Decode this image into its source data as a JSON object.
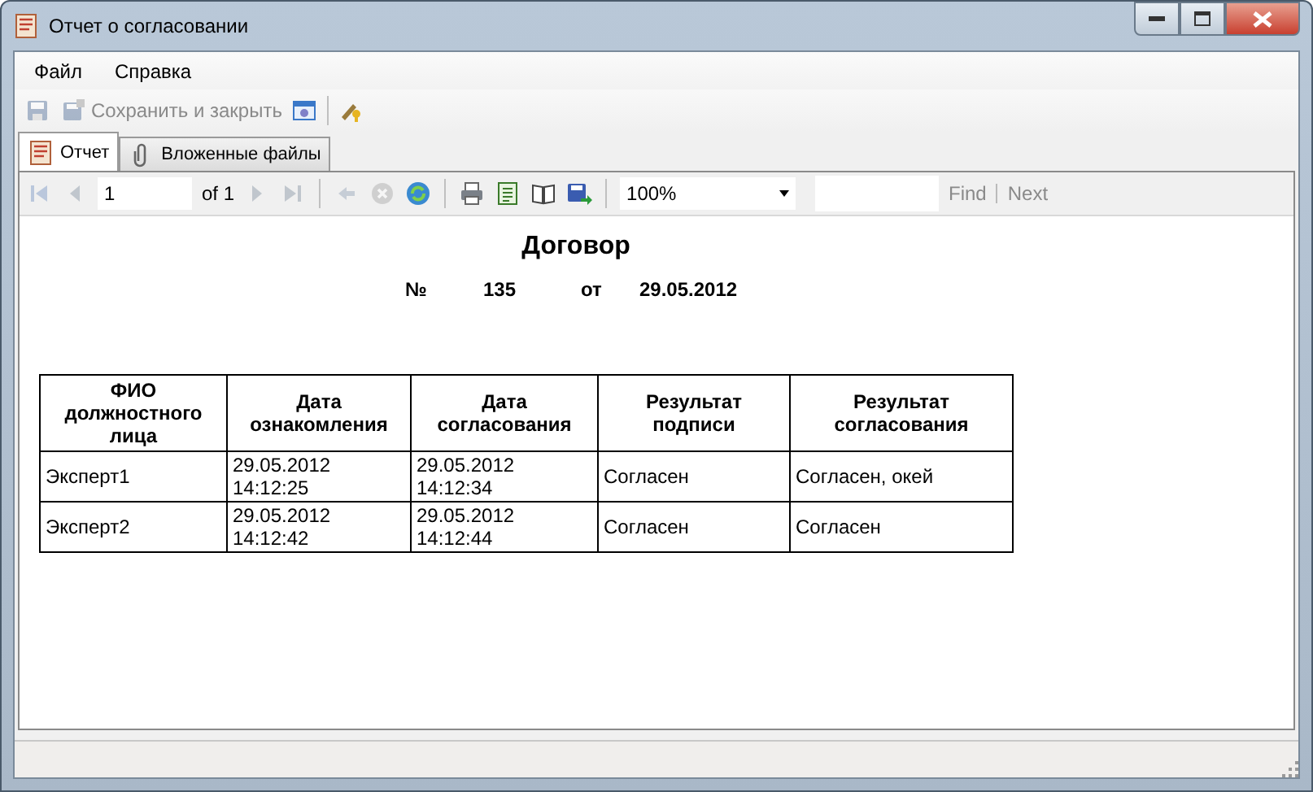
{
  "window": {
    "title": "Отчет о согласовании"
  },
  "menu": [
    {
      "label": "Файл"
    },
    {
      "label": "Справка"
    }
  ],
  "toolbar": [
    {
      "kind": "save",
      "disabled": true
    },
    {
      "kind": "save_close",
      "label": "Сохранить и закрыть",
      "disabled": true
    },
    {
      "kind": "window",
      "disabled": false
    },
    {
      "kind": "key",
      "disabled": false
    }
  ],
  "tabs": [
    {
      "kind": "report",
      "label": "Отчет",
      "selected": true
    },
    {
      "kind": "attach",
      "label": "Вложенные файлы",
      "selected": false
    }
  ],
  "viewer_toolbar": {
    "nav_before": [
      {
        "kind": "first",
        "disabled": true
      },
      {
        "kind": "prev",
        "disabled": true
      }
    ],
    "page": "1",
    "page_count": "of 1",
    "nav_after": [
      {
        "kind": "next",
        "disabled": true
      },
      {
        "kind": "last",
        "disabled": true
      }
    ],
    "actions": [
      {
        "kind": "back",
        "disabled": true
      },
      {
        "kind": "stop",
        "disabled": true
      },
      {
        "kind": "refresh",
        "disabled": false
      },
      {
        "kind": "print",
        "disabled": false
      },
      {
        "kind": "layout",
        "disabled": false
      },
      {
        "kind": "page_setup",
        "disabled": false
      },
      {
        "kind": "export",
        "disabled": false
      }
    ],
    "zoom": "100%",
    "find": {
      "label": "Find",
      "disabled": true
    },
    "next": {
      "label": "Next",
      "disabled": true
    }
  },
  "report": {
    "title": "Договор",
    "number_label": "№",
    "number": "135",
    "date_label": "от",
    "date": "29.05.2012",
    "columns": [
      "ФИО\nдолжностного\nлица",
      "Дата\nознакомления",
      "Дата\nсогласования",
      "Результат\nподписи",
      "Результат\nсогласования"
    ],
    "rows": [
      [
        "Эксперт1",
        "29.05.2012\n14:12:25",
        "29.05.2012\n14:12:34",
        "Согласен",
        "Согласен, окей"
      ],
      [
        "Эксперт2",
        "29.05.2012\n14:12:42",
        "29.05.2012\n14:12:44",
        "Согласен",
        "Согласен"
      ]
    ]
  }
}
